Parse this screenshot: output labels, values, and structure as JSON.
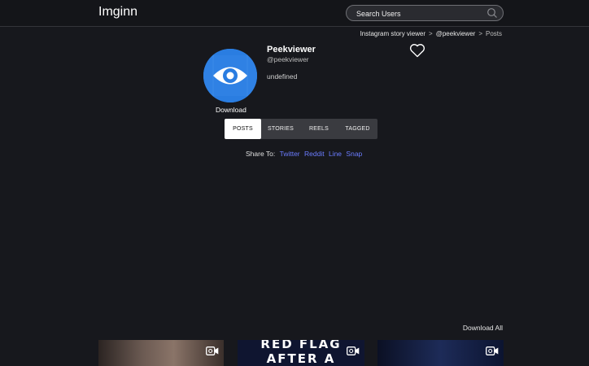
{
  "header": {
    "logo": "Imginn",
    "search_placeholder": "Search Users"
  },
  "breadcrumb": {
    "items": [
      "Instagram story viewer",
      "@peekviewer",
      "Posts"
    ],
    "separator": ">"
  },
  "profile": {
    "name": "Peekviewer",
    "handle": "@peekviewer",
    "bio": "undefined",
    "download_label": "Download"
  },
  "tabs": [
    {
      "label": "POSTS",
      "active": true
    },
    {
      "label": "STORIES",
      "active": false
    },
    {
      "label": "REELS",
      "active": false
    },
    {
      "label": "TAGGED",
      "active": false
    }
  ],
  "share": {
    "label": "Share To:",
    "targets": [
      "Twitter",
      "Reddit",
      "Line",
      "Snap"
    ]
  },
  "download_all": "Download All",
  "posts": [
    {
      "text_lines": [],
      "icon": "video-icon"
    },
    {
      "text_lines": [
        "RED FLAG",
        "AFTER A"
      ],
      "icon": "video-icon"
    },
    {
      "text_lines": [],
      "icon": "video-icon"
    }
  ],
  "colors": {
    "background": "#17181d",
    "link": "#6b7cff",
    "avatar": "#2a7de1"
  }
}
